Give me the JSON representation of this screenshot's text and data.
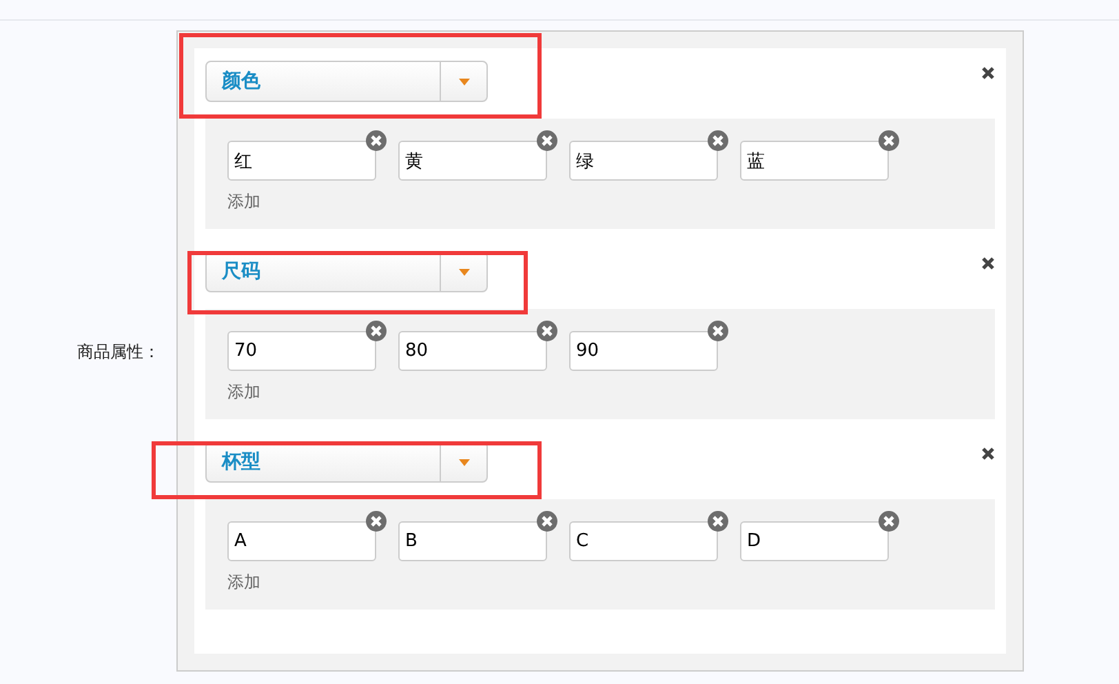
{
  "field_label": "商品属性：",
  "groups": [
    {
      "name": "颜色",
      "highlighted": true,
      "values": [
        "红",
        "黄",
        "绿",
        "蓝"
      ],
      "add_link": "添加"
    },
    {
      "name": "尺码",
      "highlighted": true,
      "values": [
        "70",
        "80",
        "90"
      ],
      "add_link": "添加"
    },
    {
      "name": "杯型",
      "highlighted": true,
      "values": [
        "A",
        "B",
        "C",
        "D"
      ],
      "add_link": "添加"
    }
  ]
}
